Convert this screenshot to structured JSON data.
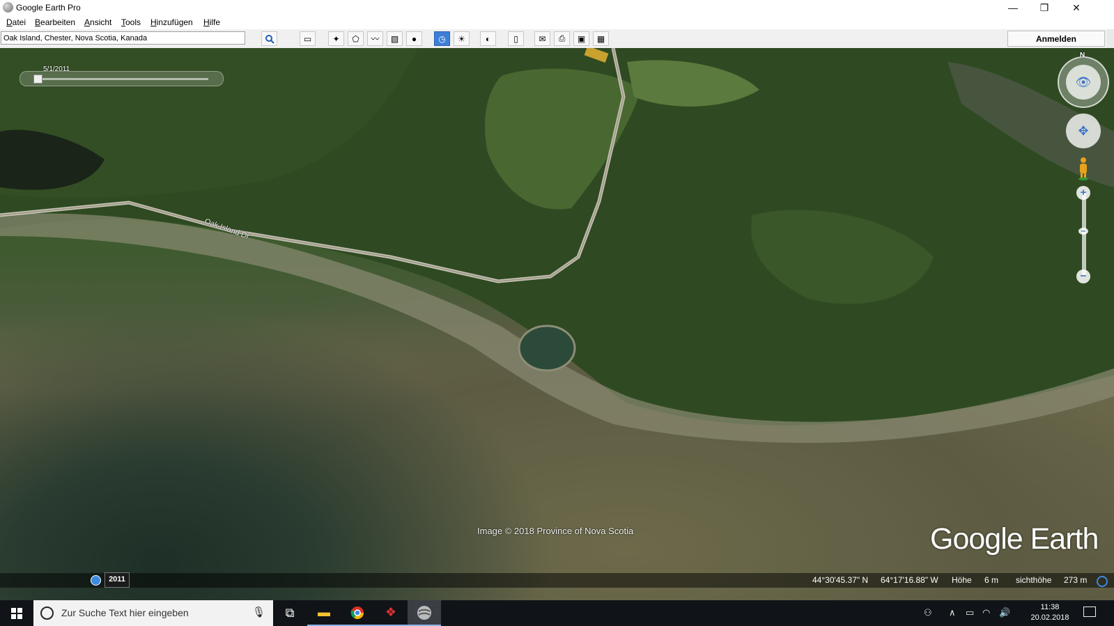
{
  "window": {
    "title": "Google Earth Pro",
    "minimize_glyph": "—",
    "restore_glyph": "❐",
    "close_glyph": "✕"
  },
  "menu": [
    "Datei",
    "Bearbeiten",
    "Ansicht",
    "Tools",
    "Hinzufügen",
    "Hilfe"
  ],
  "toolbar": {
    "search_value": "Oak Island, Chester, Nova Scotia, Kanada",
    "search_icon": "magnifier-icon",
    "login_label": "Anmelden",
    "icons": [
      "sidebar-toggle-icon",
      "placemark-icon",
      "polygon-icon",
      "path-icon",
      "image-overlay-icon",
      "record-tour-icon",
      "historical-imagery-icon",
      "sunlight-icon",
      "planets-icon",
      "ruler-icon",
      "email-icon",
      "print-icon",
      "save-image-icon",
      "view-in-maps-icon"
    ],
    "active_icon": "historical-imagery-icon"
  },
  "map": {
    "time_slider_date": "5/1/2011",
    "road_label": "Oak Island Dr",
    "copyright": "Image © 2018 Province of Nova Scotia",
    "brand": "Google Earth",
    "compass_north": "N",
    "zoom_plus": "+",
    "zoom_minus": "−"
  },
  "status": {
    "imagery_year": "2011",
    "latitude": "44°30'45.37\" N",
    "longitude": "64°17'16.88\" W",
    "elevation_label": "Höhe",
    "elevation_value": "6 m",
    "eye_alt_label": "sichthöhe",
    "eye_alt_value": "273 m"
  },
  "taskbar": {
    "search_placeholder": "Zur Suche Text hier eingeben",
    "apps": [
      "task-view-icon",
      "file-explorer-icon",
      "chrome-icon",
      "app-red-icon",
      "google-earth-icon"
    ],
    "time": "11:38",
    "date": "20.02.2018"
  }
}
